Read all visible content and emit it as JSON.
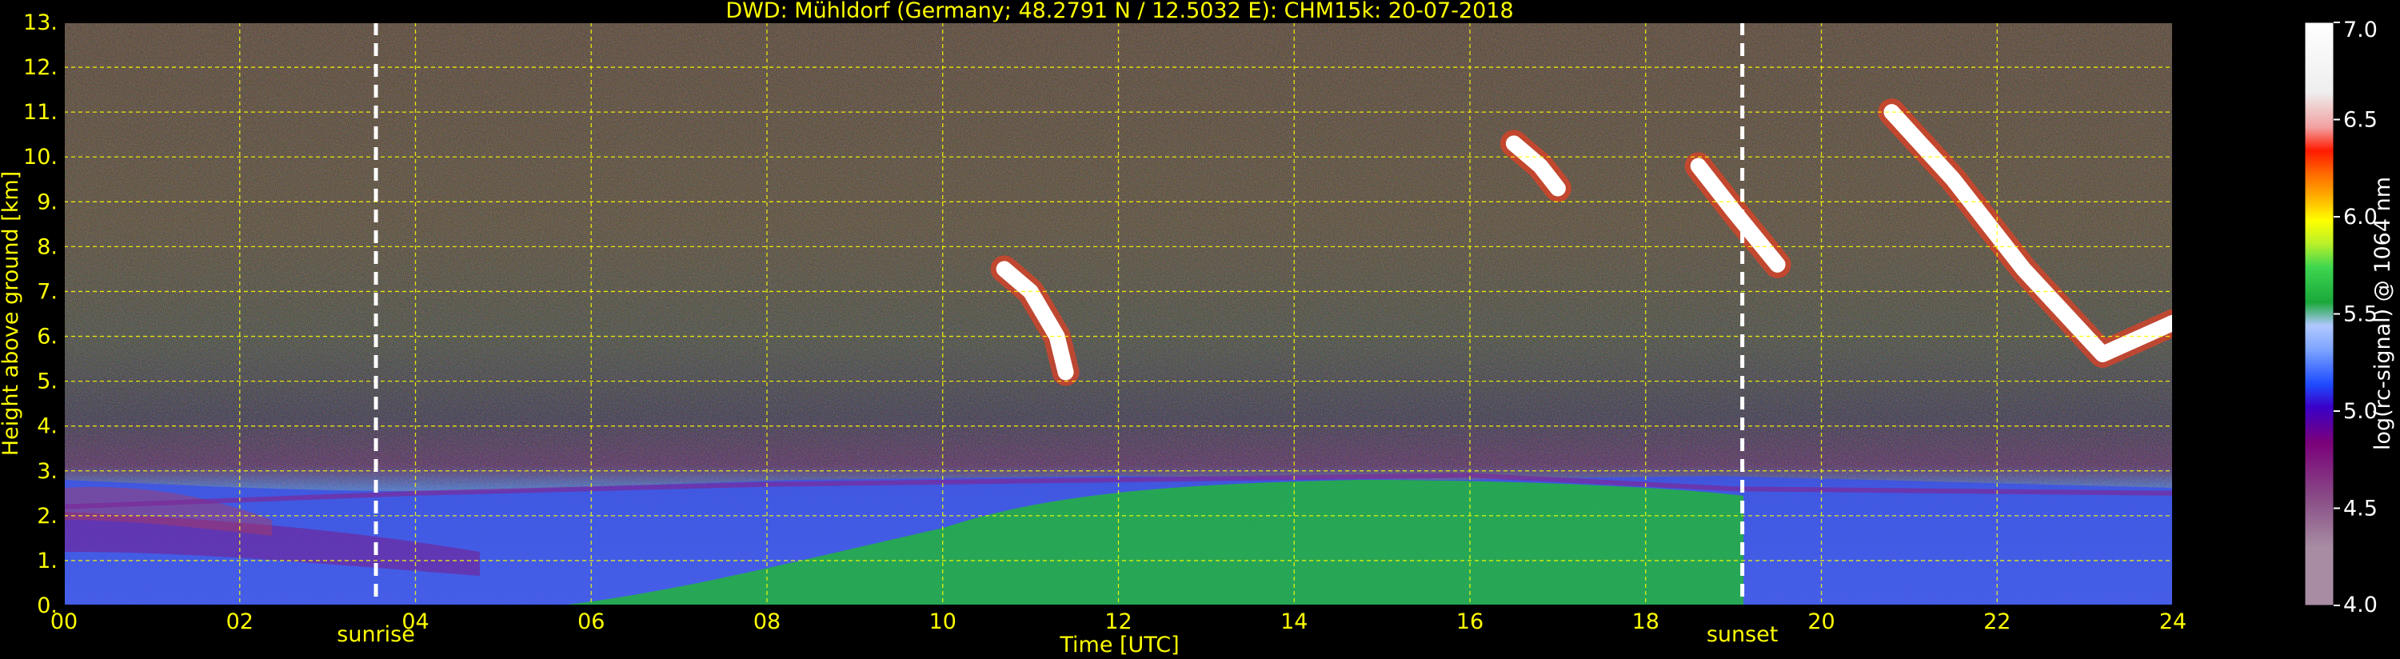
{
  "chart_data": {
    "type": "heatmap",
    "title": "DWD: Mühldorf (Germany; 48.2791 N / 12.5032 E):    CHM15k: 20-07-2018",
    "xlabel": "Time [UTC]",
    "ylabel": "Height above ground [km]",
    "xlim": [
      0,
      24
    ],
    "ylim": [
      0,
      13
    ],
    "x_ticks": [
      "00",
      "02",
      "04",
      "06",
      "08",
      "10",
      "12",
      "14",
      "16",
      "18",
      "20",
      "22",
      "24"
    ],
    "y_ticks": [
      "0.",
      "1.",
      "2.",
      "3.",
      "4.",
      "5.",
      "6.",
      "7.",
      "8.",
      "9.",
      "10.",
      "11.",
      "12.",
      "13."
    ],
    "grid": true,
    "colorbar": {
      "label": "log(rc-signal) @ 1064 nm",
      "range": [
        4.0,
        7.0
      ],
      "ticks": [
        "4.0",
        "4.5",
        "5.0",
        "5.5",
        "6.0",
        "6.5",
        "7.0"
      ]
    },
    "markers": [
      {
        "label": "sunrise",
        "time": 3.55
      },
      {
        "label": "sunset",
        "time": 19.1
      }
    ],
    "features": {
      "boundary_layer_top_km": [
        {
          "time": 0,
          "height": 2.2
        },
        {
          "time": 4,
          "height": 2.5
        },
        {
          "time": 8,
          "height": 2.7
        },
        {
          "time": 12,
          "height": 2.8
        },
        {
          "time": 16,
          "height": 2.9
        },
        {
          "time": 19,
          "height": 2.6
        },
        {
          "time": 24,
          "height": 2.5
        }
      ],
      "cloud_tracks": [
        {
          "time": [
            10.7,
            11.0,
            11.3,
            11.4
          ],
          "height": [
            7.5,
            7.0,
            6.0,
            5.2
          ]
        },
        {
          "time": [
            16.5,
            16.8,
            17.0
          ],
          "height": [
            10.3,
            9.8,
            9.3
          ]
        },
        {
          "time": [
            18.6,
            19.0,
            19.5
          ],
          "height": [
            9.8,
            8.8,
            7.6
          ]
        },
        {
          "time": [
            20.8,
            21.5,
            22.3,
            23.2,
            24.0
          ],
          "height": [
            11.0,
            9.5,
            7.5,
            5.6,
            6.3
          ]
        }
      ]
    },
    "colors": {
      "axis_text": "#ffff00",
      "grid": "#ffff00",
      "marker_line": "#ffffff",
      "colorbar_stops": [
        "#a78ca3",
        "#8a4f87",
        "#7a007a",
        "#3a00c8",
        "#1e4cff",
        "#7fa6ff",
        "#b0c8ff",
        "#1aa83a",
        "#3ed650",
        "#b8f02a",
        "#ffff00",
        "#ffb000",
        "#ff6a00",
        "#ff1a00",
        "#f2a0a0",
        "#eeeeee",
        "#ffffff"
      ]
    }
  }
}
